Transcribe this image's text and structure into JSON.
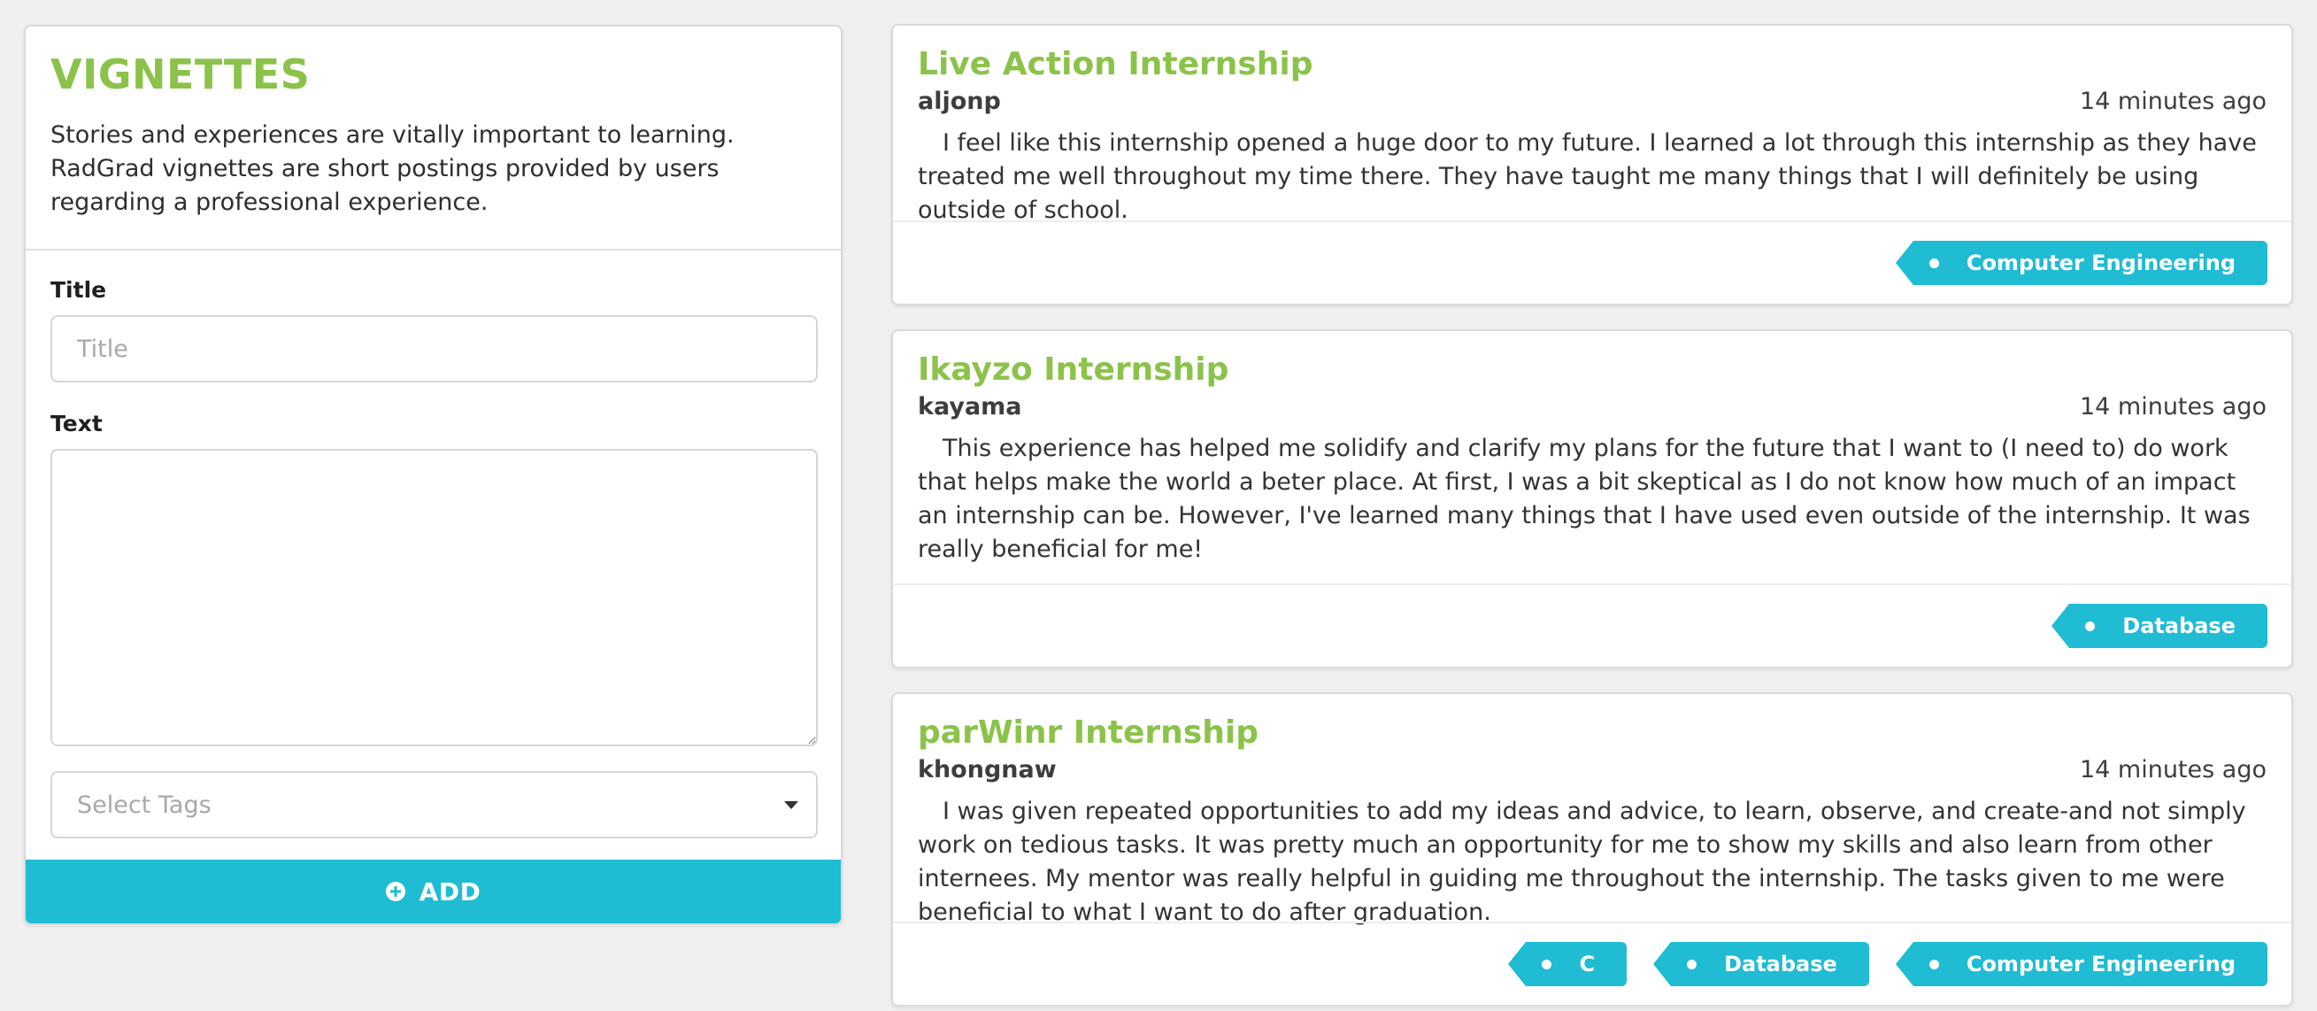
{
  "form": {
    "heading": "VIGNETTES",
    "intro": "Stories and experiences are vitally important to learning. RadGrad vignettes are short postings provided by users regarding a professional experience.",
    "title_label": "Title",
    "title_placeholder": "Title",
    "title_value": "",
    "text_label": "Text",
    "text_value": "",
    "tags_placeholder": "Select Tags",
    "add_label": "ADD",
    "add_icon": "plus-circle-icon",
    "accent_color": "#1fbcd3",
    "heading_color": "#8bc34a"
  },
  "vignettes": [
    {
      "title": "Live Action Internship",
      "author": "aljonp",
      "time": "14 minutes ago",
      "text": "I feel like this internship opened a huge door to my future. I learned a lot through this internship as they have treated me well throughout my time there. They have taught me many things that I will definitely be using outside of school.",
      "tags": [
        "Computer Engineering"
      ]
    },
    {
      "title": "Ikayzo Internship",
      "author": "kayama",
      "time": "14 minutes ago",
      "text": "This experience has helped me solidify and clarify my plans for the future that I want to (I need to) do work that helps make the world a beter place. At first, I was a bit skeptical as I do not know how much of an impact an internship can be. However, I've learned many things that I have used even outside of the internship. It was really beneficial for me!",
      "tags": [
        "Database"
      ]
    },
    {
      "title": "parWinr Internship",
      "author": "khongnaw",
      "time": "14 minutes ago",
      "text": "I was given repeated opportunities to add my ideas and advice, to learn, observe, and create-and not simply work on tedious tasks. It was pretty much an opportunity for me to show my skills and also learn from other internees. My mentor was really helpful in guiding me throughout the internship. The tasks given to me were beneficial to what I want to do after graduation.",
      "tags": [
        "C",
        "Database",
        "Computer Engineering"
      ]
    }
  ]
}
